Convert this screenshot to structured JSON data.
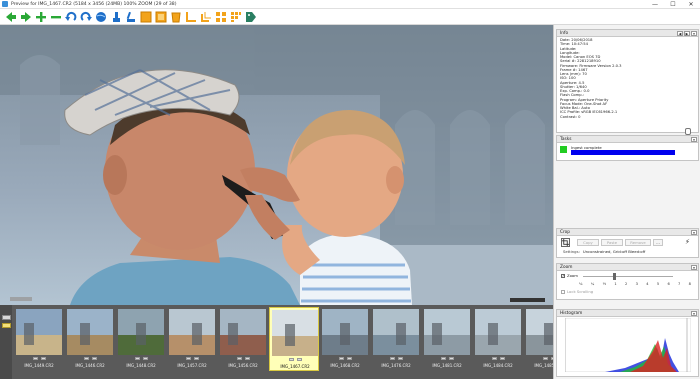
{
  "window": {
    "title": "Preview for IMG_1467.CR2 (5184 x 3456 (24MB) 100% ZOOM (29 of 38)",
    "controls": [
      "—",
      "☐",
      "✕"
    ]
  },
  "toolbar": {
    "icons": [
      "arrow-left-icon",
      "arrow-right-icon",
      "add-icon",
      "remove-icon",
      "rotate-left-icon",
      "rotate-right-icon",
      "globe-icon",
      "paint-icon",
      "clear-icon",
      "frame-single-icon",
      "frame-double-icon",
      "bucket-icon",
      "crop-corner-icon",
      "crop-corner-alt-icon",
      "grid-a-icon",
      "grid-b-icon",
      "tag-icon"
    ]
  },
  "filmstrip": {
    "thumbnails": [
      {
        "name": "IMG_1449.CR2",
        "selected": false
      },
      {
        "name": "IMG_1446.CR2",
        "selected": false
      },
      {
        "name": "IMG_1448.CR2",
        "selected": false
      },
      {
        "name": "IMG_1457.CR2",
        "selected": false
      },
      {
        "name": "IMG_1456.CR2",
        "selected": false
      },
      {
        "name": "IMG_1467.CR2",
        "selected": true
      },
      {
        "name": "IMG_1468.CR2",
        "selected": false
      },
      {
        "name": "IMG_1476.CR2",
        "selected": false
      },
      {
        "name": "IMG_1481.CR2",
        "selected": false
      },
      {
        "name": "IMG_1484.CR2",
        "selected": false
      },
      {
        "name": "IMG_1485.CR2",
        "selected": false
      }
    ]
  },
  "info": {
    "title": "Info",
    "lines": [
      "Date: 20/06/2018",
      "Time: 10:47:54",
      "Latitude:",
      "Longitude:",
      "Model: Canon EOS 7D",
      "Serial #: 2281218910",
      "Firmware: Firmware Version 2.0.3",
      "Frame #: 1467",
      "Lens (mm): 70",
      "ISO: 100",
      "Aperture: 4.5",
      "Shutter: 1/640",
      "Exp. Comp.: 0.0",
      "Flash Comp.:",
      "Program: Aperture Priority",
      "Focus Mode: One-Shot AF",
      "White Bal.: Auto",
      "ICC Profile: sRGB IEC61966-2.1",
      "Contrast: 0"
    ]
  },
  "tasks": {
    "title": "Tasks",
    "status": "Ingest complete",
    "progress": 1.0,
    "status_color": "#22cc22",
    "bar_color": "#0000ee"
  },
  "crop": {
    "title": "Crop",
    "buttons": [
      "Copy",
      "Paste",
      "Remove",
      "..."
    ],
    "settings_label": "Settings:",
    "settings_value": "Unconstrained, Grid:off Bleed:off"
  },
  "zoom": {
    "title": "Zoom",
    "zoom_label": "Zoom",
    "zoom_checked": true,
    "levels": [
      "⅛",
      "¼",
      "½",
      "1",
      "2",
      "3",
      "4",
      "5",
      "6",
      "7",
      "8"
    ],
    "lock_label": "Lock Scrolling",
    "lock_checked": false
  },
  "histogram": {
    "title": "Histogram"
  }
}
